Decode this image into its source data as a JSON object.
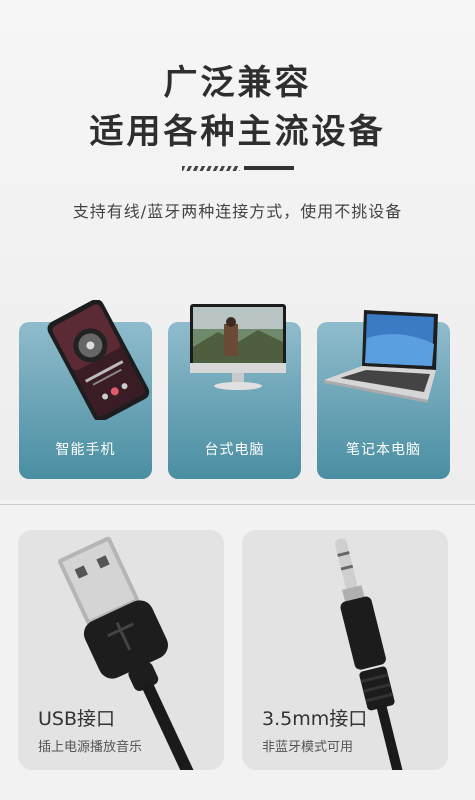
{
  "header": {
    "title_line1": "广泛兼容",
    "title_line2": "适用各种主流设备",
    "subtitle": "支持有线/蓝牙两种连接方式，使用不挑设备"
  },
  "devices": [
    {
      "label": "智能手机",
      "icon": "smartphone-icon"
    },
    {
      "label": "台式电脑",
      "icon": "desktop-monitor-icon"
    },
    {
      "label": "笔记本电脑",
      "icon": "laptop-icon"
    }
  ],
  "ports": [
    {
      "title": "USB接口",
      "description": "插上电源播放音乐",
      "icon": "usb-plug-icon"
    },
    {
      "title": "3.5mm接口",
      "description": "非蓝牙模式可用",
      "icon": "audio-jack-icon"
    }
  ],
  "colors": {
    "card_gradient_top": "#8fbccc",
    "card_gradient_bottom": "#4a8ea2",
    "title_text": "#2e2e2e",
    "port_card_bg": "#e3e3e3"
  }
}
